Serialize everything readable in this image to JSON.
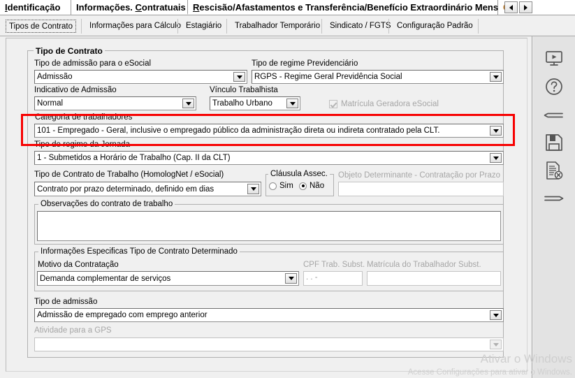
{
  "window": {
    "top_tabs": [
      {
        "label": "Identificação",
        "accel": "I",
        "selected": false
      },
      {
        "label": "Informações. Contratuais",
        "accel": "C",
        "selected": true
      },
      {
        "label": "Rescisão/Afastamentos e Transferência/Benefício Extraordinário Mensal",
        "accel": "R",
        "selected": false
      },
      {
        "label": "C",
        "accel": "",
        "selected": false,
        "partial": true
      }
    ],
    "top_tab_scroll": {
      "prev": "◀",
      "next": "▶"
    },
    "sub_tabs": [
      {
        "label": "Tipos de Contrato",
        "accel": "T",
        "selected": true
      },
      {
        "label": "Informações para Cálculo",
        "accel": "I",
        "selected": false
      },
      {
        "label": "Estagiário",
        "accel": "E",
        "selected": false
      },
      {
        "label": "Trabalhador Temporário",
        "accel": "T",
        "selected": false
      },
      {
        "label": "Sindicato / FGTS",
        "accel": "S",
        "selected": false
      },
      {
        "label": "Configuração Padrão",
        "accel": "C",
        "selected": false
      }
    ],
    "sub_tab_scroll": {
      "prev": "◀",
      "next": "▶"
    }
  },
  "form": {
    "group_tipo_contrato": {
      "title": "Tipo de Contrato",
      "tipo_admissao_esocial": {
        "label": "Tipo de admissão para o eSocial",
        "value": "Admissão"
      },
      "tipo_regime_previdenciario": {
        "label": "Tipo de regime Previdenciário",
        "value": "RGPS - Regime Geral Previdência Social"
      },
      "indicativo_admissao": {
        "label": "Indicativo de Admissão",
        "value": "Normal"
      },
      "vinculo_trabalhista": {
        "label": "Vínculo Trabalhista",
        "value": "Trabalho Urbano"
      },
      "matricula_geradora_esocial": {
        "label": "Matrícula Geradora eSocial",
        "checked": true,
        "disabled": true
      },
      "categoria_trabalhadores": {
        "label": "Categoria de trabalhadores",
        "value": "101 - Empregado - Geral, inclusive o empregado público da administração direta ou indireta contratado pela CLT.",
        "highlighted": true
      },
      "tipo_regime_jornada": {
        "label": "Tipo de regime da Jornada",
        "value": "1 - Submetidos a Horário de Trabalho (Cap. II da CLT)"
      },
      "tipo_contrato_trabalho": {
        "label": "Tipo de Contrato de Trabalho (HomologNet / eSocial)",
        "value": "Contrato por prazo determinado, definido em dias"
      },
      "clausula_assec": {
        "title": "Cláusula Assec.",
        "options": [
          {
            "label": "Sim",
            "selected": false
          },
          {
            "label": "Não",
            "selected": true
          }
        ]
      },
      "objeto_determinante": {
        "label": "Objeto Determinante - Contratação por Prazo",
        "value": "",
        "disabled": true
      },
      "observacoes": {
        "title": "Observações do contrato de trabalho",
        "value": ""
      },
      "info_especificas": {
        "title": "Informações Especificas Tipo de Contrato Determinado",
        "motivo_contratacao": {
          "label": "Motivo da Contratação",
          "value": "Demanda complementar de serviços"
        },
        "cpf_trab_subst": {
          "label": "CPF Trab. Subst.",
          "value": ".   .   -",
          "disabled": true
        },
        "matricula_trabalhador_subst": {
          "label": "Matrícula do Trabalhador Subst.",
          "value": "",
          "disabled": true
        }
      },
      "tipo_admissao": {
        "label": "Tipo de admissão",
        "value": "Admissão de empregado com emprego anterior"
      },
      "atividade_gps": {
        "label": "Atividade para a GPS",
        "value": "",
        "disabled": true
      }
    }
  },
  "sidebar": {
    "buttons": [
      {
        "icon": "video-monitor-icon",
        "title": "Vídeo"
      },
      {
        "icon": "help-question-icon",
        "title": "Ajuda"
      },
      {
        "icon": "arrow-left-icon",
        "title": "Voltar"
      },
      {
        "icon": "floppy-save-icon",
        "title": "Salvar"
      },
      {
        "icon": "document-cancel-icon",
        "title": "Cancelar"
      },
      {
        "icon": "arrow-right-icon",
        "title": "Avançar"
      }
    ]
  },
  "watermark": {
    "line1": "Ativar o Windows",
    "line2": "Acesse Configurações para ativar o Windows."
  },
  "colors": {
    "highlight": "#f70000",
    "panel_bg": "#f0f0f0",
    "sidebar_bg": "#e3e3e3",
    "field_bg": "#ffffff",
    "disabled_text": "#a6a6a6"
  }
}
